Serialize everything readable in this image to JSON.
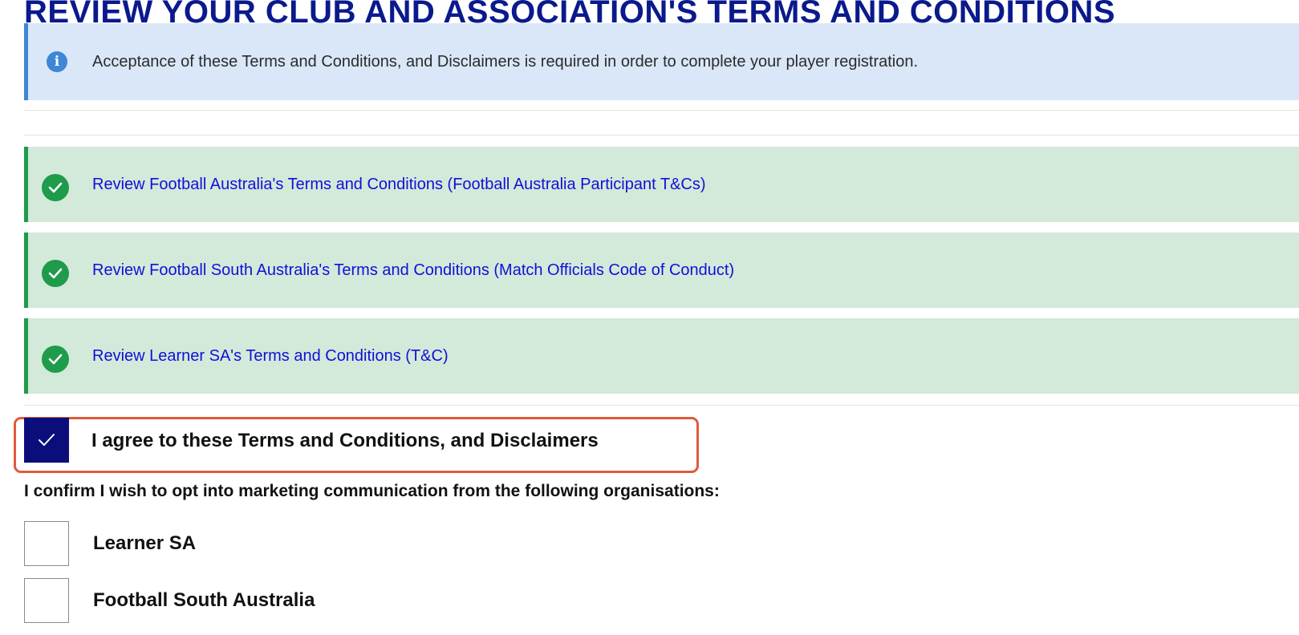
{
  "page": {
    "title": "REVIEW YOUR CLUB AND ASSOCIATION'S TERMS AND CONDITIONS"
  },
  "info": {
    "icon": "info-icon",
    "text": "Acceptance of these Terms and Conditions, and Disclaimers is required in order to complete your player registration."
  },
  "reviews": [
    {
      "label": "Review Football Australia's Terms and Conditions (Football Australia Participant T&Cs)",
      "status": "reviewed"
    },
    {
      "label": "Review Football South Australia's Terms and Conditions (Match Officials Code of Conduct)",
      "status": "reviewed"
    },
    {
      "label": "Review Learner SA's Terms and Conditions (T&C)",
      "status": "reviewed"
    }
  ],
  "agreement": {
    "label": "I agree to these Terms and Conditions, and Disclaimers",
    "checked": true
  },
  "marketing": {
    "prompt": "I confirm I wish to opt into marketing communication from the following organisations:",
    "options": [
      {
        "label": "Learner SA",
        "checked": false
      },
      {
        "label": "Football South Australia",
        "checked": false
      }
    ]
  },
  "colors": {
    "title": "#0a1a8c",
    "info_bg": "#d9e7f8",
    "info_accent": "#3e86d6",
    "success_bg": "#d3e9da",
    "success_accent": "#1e9b4b",
    "link": "#1010d8",
    "checkbox_checked": "#0b0e7a",
    "highlight_border": "#e05a3d"
  }
}
